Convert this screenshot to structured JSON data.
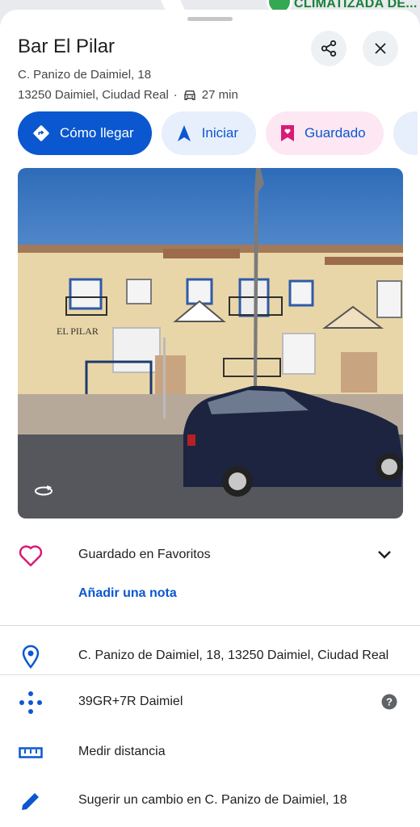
{
  "map": {
    "poi_label": "CLIMATIZADA DE..."
  },
  "place": {
    "title": "Bar El Pilar",
    "address_line1": "C. Panizo de Daimiel, 18",
    "address_line2": "13250 Daimiel, Ciudad Real",
    "separator": "·",
    "drive_time": "27 min"
  },
  "header_buttons": {
    "share_icon": "share-icon",
    "close_icon": "close-icon"
  },
  "actions": {
    "directions": "Cómo llegar",
    "start": "Iniciar",
    "saved": "Guardado"
  },
  "details": {
    "saved_list": "Guardado en Favoritos",
    "add_note": "Añadir una nota",
    "full_address": "C. Panizo de Daimiel, 18, 13250 Daimiel, Ciudad Real",
    "plus_code": "39GR+7R Daimiel",
    "measure": "Medir distancia",
    "suggest_edit": "Sugerir un cambio en C. Panizo de Daimiel, 18"
  },
  "colors": {
    "primary": "#0b57d0",
    "saved_pink": "#d81b77",
    "chip_bg": "#e7effc"
  }
}
